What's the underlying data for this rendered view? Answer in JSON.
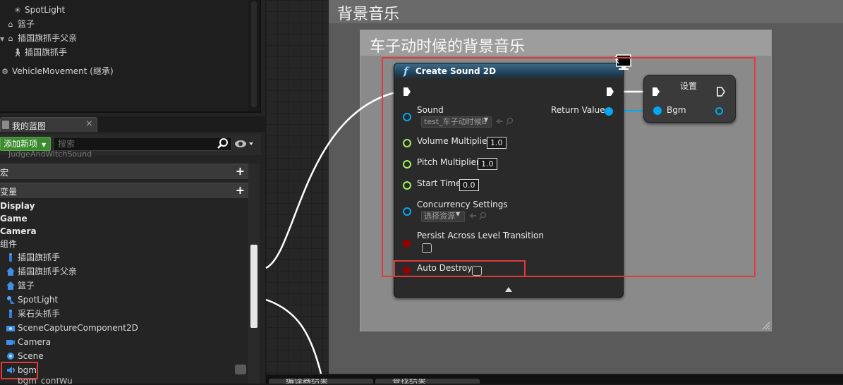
{
  "component_tree": {
    "items": [
      {
        "label": "SpotLight",
        "icon": "spotlight-icon"
      },
      {
        "label": "篮子",
        "icon": "scene-component-icon"
      },
      {
        "label": "插国旗抓手父亲",
        "icon": "scene-component-icon"
      },
      {
        "label": "插国旗抓手",
        "icon": "physics-handle-icon"
      },
      {
        "label": "VehicleMovement (继承)",
        "icon": "vehicle-movement-icon"
      }
    ]
  },
  "my_blueprint": {
    "tab_label": "我的蓝图",
    "tab_close": "×",
    "add_new_label": "添加新项",
    "search_placeholder": "搜索",
    "truncated_item": "JudgeAndWitchSound",
    "sections": {
      "macros": "宏",
      "variables": "变量",
      "plus": "+"
    },
    "categories": [
      "Display",
      "Game",
      "Camera",
      "组件"
    ],
    "components": [
      {
        "label": "插国旗抓手",
        "icon": "physics-handle-icon"
      },
      {
        "label": "插国旗抓手父亲",
        "icon": "scene-component-icon"
      },
      {
        "label": "篮子",
        "icon": "scene-component-icon"
      },
      {
        "label": "SpotLight",
        "icon": "spotlight-icon"
      },
      {
        "label": "采石头抓手",
        "icon": "physics-handle-icon"
      },
      {
        "label": "SceneCaptureComponent2D",
        "icon": "scene-capture-icon"
      },
      {
        "label": "Camera",
        "icon": "camera-icon"
      },
      {
        "label": "Scene",
        "icon": "scene-icon"
      },
      {
        "label": "bgm",
        "icon": "audio-component-icon"
      }
    ],
    "cut_row": "bgm_confWu"
  },
  "graph": {
    "outer_comment_title": "背景音乐",
    "inner_comment_title": "车子动时候的背景音乐",
    "create_sound_node": {
      "icon_glyph": "f",
      "title": "Create Sound 2D",
      "pins": {
        "sound": "Sound",
        "sound_value": "test_车子动时候B",
        "return_value": "Return Value",
        "volume_multiplier": "Volume Multiplier",
        "volume_multiplier_value": "1.0",
        "pitch_multiplier": "Pitch Multiplier",
        "pitch_multiplier_value": "1.0",
        "start_time": "Start Time",
        "start_time_value": "0.0",
        "concurrency_settings": "Concurrency Settings",
        "concurrency_value": "选择资源",
        "persist_across_level_transition": "Persist Across Level Transition",
        "auto_destroy": "Auto Destroy"
      }
    },
    "set_node": {
      "title": "设置",
      "variable": "Bgm"
    }
  },
  "bottom_tabs": [
    "编译器结果",
    "查找结果"
  ],
  "colors": {
    "exec_pin": "#ffffff",
    "object_pin": "#00a8f4",
    "float_pin": "#9ff65b",
    "bool_pin": "#950000",
    "highlight": "#e03a3a",
    "add_button": "#3b8a2e"
  }
}
